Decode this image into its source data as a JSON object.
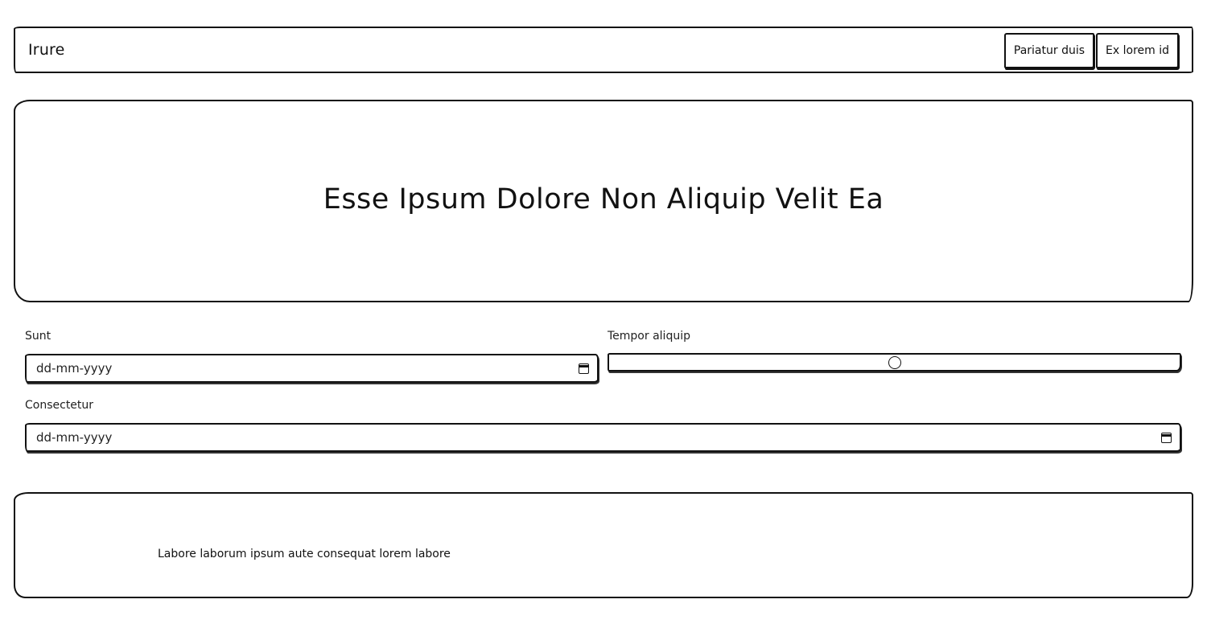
{
  "header": {
    "brand": "Irure",
    "nav": [
      "Pariatur duis",
      "Ex lorem id"
    ]
  },
  "hero": {
    "title": "Esse Ipsum Dolore Non Aliquip Velit Ea"
  },
  "form": {
    "sunt": {
      "label": "Sunt",
      "placeholder": "dd-mm-yyyy"
    },
    "tempor": {
      "label": "Tempor aliquip",
      "value_fraction": 0.5
    },
    "consectetur": {
      "label": "Consectetur",
      "placeholder": "dd-mm-yyyy"
    }
  },
  "footer": {
    "text": "Labore laborum ipsum aute consequat lorem labore"
  },
  "icons": {
    "calendar": "calendar-icon"
  }
}
